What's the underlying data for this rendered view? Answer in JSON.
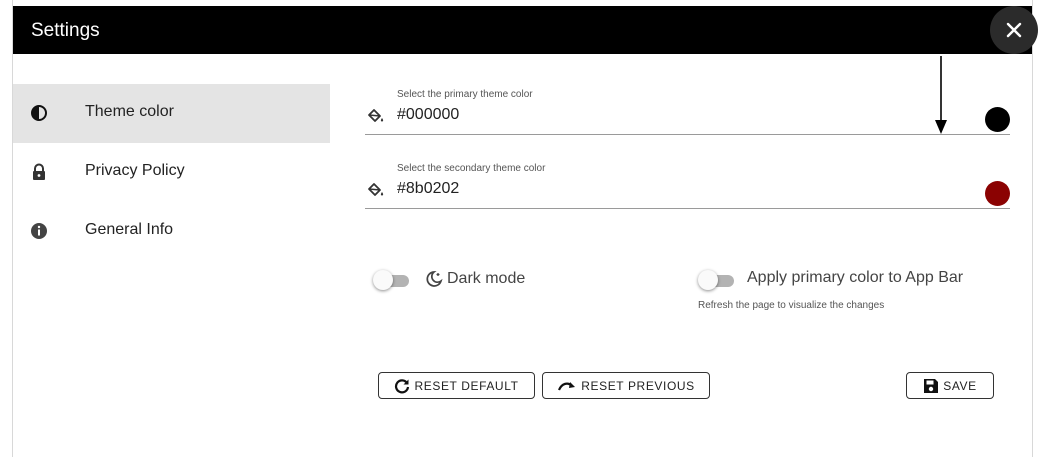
{
  "dialog": {
    "title": "Settings",
    "close_icon": "close-icon"
  },
  "sidebar": {
    "items": [
      {
        "label": "Theme color",
        "icon": "contrast-icon",
        "active": true
      },
      {
        "label": "Privacy Policy",
        "icon": "lock-icon",
        "active": false
      },
      {
        "label": "General Info",
        "icon": "info-icon",
        "active": false
      }
    ]
  },
  "theme": {
    "primary": {
      "helper": "Select the primary theme color",
      "value": "#000000",
      "swatch": "#000000",
      "icon": "paint-bucket-icon"
    },
    "secondary": {
      "helper": "Select the secondary theme color",
      "value": "#8b0202",
      "swatch": "#8b0202",
      "icon": "paint-bucket-icon"
    }
  },
  "toggles": {
    "dark_mode": {
      "label": "Dark mode",
      "icon": "night-mode-icon",
      "checked": false
    },
    "app_bar": {
      "label": "Apply primary color to App Bar",
      "hint": "Refresh the page to visualize the changes",
      "checked": false
    }
  },
  "actions": {
    "reset_default": "RESET DEFAULT",
    "reset_previous": "RESET PREVIOUS",
    "save": "SAVE"
  }
}
